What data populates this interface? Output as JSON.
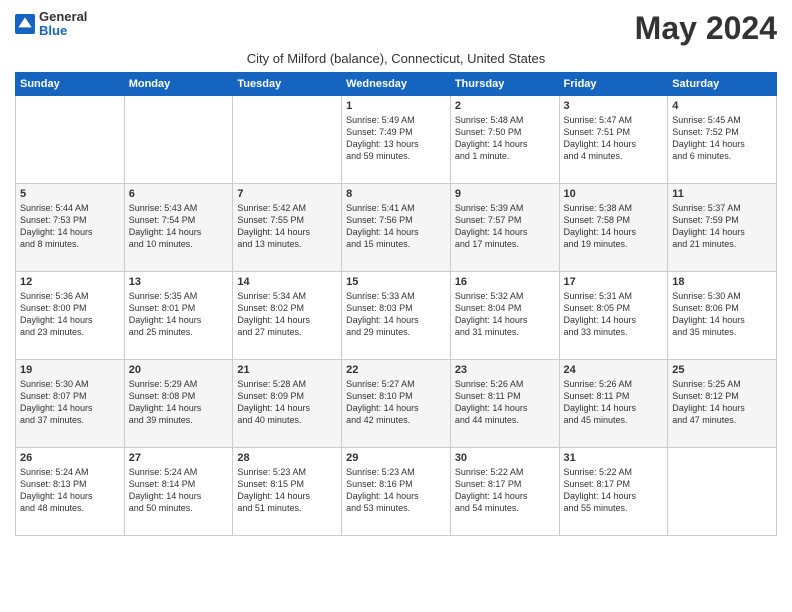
{
  "logo": {
    "text_general": "General",
    "text_blue": "Blue"
  },
  "title": "May 2024",
  "subtitle": "City of Milford (balance), Connecticut, United States",
  "days_of_week": [
    "Sunday",
    "Monday",
    "Tuesday",
    "Wednesday",
    "Thursday",
    "Friday",
    "Saturday"
  ],
  "weeks": [
    [
      {
        "day": "",
        "detail": ""
      },
      {
        "day": "",
        "detail": ""
      },
      {
        "day": "",
        "detail": ""
      },
      {
        "day": "1",
        "detail": "Sunrise: 5:49 AM\nSunset: 7:49 PM\nDaylight: 13 hours\nand 59 minutes."
      },
      {
        "day": "2",
        "detail": "Sunrise: 5:48 AM\nSunset: 7:50 PM\nDaylight: 14 hours\nand 1 minute."
      },
      {
        "day": "3",
        "detail": "Sunrise: 5:47 AM\nSunset: 7:51 PM\nDaylight: 14 hours\nand 4 minutes."
      },
      {
        "day": "4",
        "detail": "Sunrise: 5:45 AM\nSunset: 7:52 PM\nDaylight: 14 hours\nand 6 minutes."
      }
    ],
    [
      {
        "day": "5",
        "detail": "Sunrise: 5:44 AM\nSunset: 7:53 PM\nDaylight: 14 hours\nand 8 minutes."
      },
      {
        "day": "6",
        "detail": "Sunrise: 5:43 AM\nSunset: 7:54 PM\nDaylight: 14 hours\nand 10 minutes."
      },
      {
        "day": "7",
        "detail": "Sunrise: 5:42 AM\nSunset: 7:55 PM\nDaylight: 14 hours\nand 13 minutes."
      },
      {
        "day": "8",
        "detail": "Sunrise: 5:41 AM\nSunset: 7:56 PM\nDaylight: 14 hours\nand 15 minutes."
      },
      {
        "day": "9",
        "detail": "Sunrise: 5:39 AM\nSunset: 7:57 PM\nDaylight: 14 hours\nand 17 minutes."
      },
      {
        "day": "10",
        "detail": "Sunrise: 5:38 AM\nSunset: 7:58 PM\nDaylight: 14 hours\nand 19 minutes."
      },
      {
        "day": "11",
        "detail": "Sunrise: 5:37 AM\nSunset: 7:59 PM\nDaylight: 14 hours\nand 21 minutes."
      }
    ],
    [
      {
        "day": "12",
        "detail": "Sunrise: 5:36 AM\nSunset: 8:00 PM\nDaylight: 14 hours\nand 23 minutes."
      },
      {
        "day": "13",
        "detail": "Sunrise: 5:35 AM\nSunset: 8:01 PM\nDaylight: 14 hours\nand 25 minutes."
      },
      {
        "day": "14",
        "detail": "Sunrise: 5:34 AM\nSunset: 8:02 PM\nDaylight: 14 hours\nand 27 minutes."
      },
      {
        "day": "15",
        "detail": "Sunrise: 5:33 AM\nSunset: 8:03 PM\nDaylight: 14 hours\nand 29 minutes."
      },
      {
        "day": "16",
        "detail": "Sunrise: 5:32 AM\nSunset: 8:04 PM\nDaylight: 14 hours\nand 31 minutes."
      },
      {
        "day": "17",
        "detail": "Sunrise: 5:31 AM\nSunset: 8:05 PM\nDaylight: 14 hours\nand 33 minutes."
      },
      {
        "day": "18",
        "detail": "Sunrise: 5:30 AM\nSunset: 8:06 PM\nDaylight: 14 hours\nand 35 minutes."
      }
    ],
    [
      {
        "day": "19",
        "detail": "Sunrise: 5:30 AM\nSunset: 8:07 PM\nDaylight: 14 hours\nand 37 minutes."
      },
      {
        "day": "20",
        "detail": "Sunrise: 5:29 AM\nSunset: 8:08 PM\nDaylight: 14 hours\nand 39 minutes."
      },
      {
        "day": "21",
        "detail": "Sunrise: 5:28 AM\nSunset: 8:09 PM\nDaylight: 14 hours\nand 40 minutes."
      },
      {
        "day": "22",
        "detail": "Sunrise: 5:27 AM\nSunset: 8:10 PM\nDaylight: 14 hours\nand 42 minutes."
      },
      {
        "day": "23",
        "detail": "Sunrise: 5:26 AM\nSunset: 8:11 PM\nDaylight: 14 hours\nand 44 minutes."
      },
      {
        "day": "24",
        "detail": "Sunrise: 5:26 AM\nSunset: 8:11 PM\nDaylight: 14 hours\nand 45 minutes."
      },
      {
        "day": "25",
        "detail": "Sunrise: 5:25 AM\nSunset: 8:12 PM\nDaylight: 14 hours\nand 47 minutes."
      }
    ],
    [
      {
        "day": "26",
        "detail": "Sunrise: 5:24 AM\nSunset: 8:13 PM\nDaylight: 14 hours\nand 48 minutes."
      },
      {
        "day": "27",
        "detail": "Sunrise: 5:24 AM\nSunset: 8:14 PM\nDaylight: 14 hours\nand 50 minutes."
      },
      {
        "day": "28",
        "detail": "Sunrise: 5:23 AM\nSunset: 8:15 PM\nDaylight: 14 hours\nand 51 minutes."
      },
      {
        "day": "29",
        "detail": "Sunrise: 5:23 AM\nSunset: 8:16 PM\nDaylight: 14 hours\nand 53 minutes."
      },
      {
        "day": "30",
        "detail": "Sunrise: 5:22 AM\nSunset: 8:17 PM\nDaylight: 14 hours\nand 54 minutes."
      },
      {
        "day": "31",
        "detail": "Sunrise: 5:22 AM\nSunset: 8:17 PM\nDaylight: 14 hours\nand 55 minutes."
      },
      {
        "day": "",
        "detail": ""
      }
    ]
  ]
}
